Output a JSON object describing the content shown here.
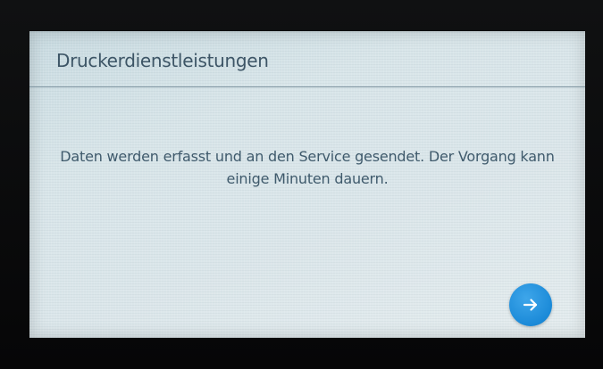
{
  "header": {
    "title": "Druckerdienstleistungen"
  },
  "main": {
    "message": "Daten werden erfasst und an den Service gesendet. Der Vorgang kann einige Minuten dauern."
  },
  "actions": {
    "next_icon": "arrow-right-icon"
  },
  "colors": {
    "screen_background": "#d8e5e9",
    "text": "#3f5a6c",
    "accent": "#1b8ad8"
  }
}
